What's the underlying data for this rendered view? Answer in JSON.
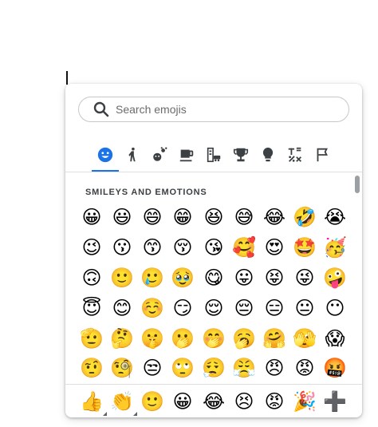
{
  "search": {
    "placeholder": "Search emojis",
    "value": ""
  },
  "tabs": [
    {
      "name": "smileys-emotions",
      "icon": "smiley-face-icon",
      "active": true
    },
    {
      "name": "people-body",
      "icon": "person-walking-icon",
      "active": false
    },
    {
      "name": "animals-nature",
      "icon": "animals-nature-icon",
      "active": false
    },
    {
      "name": "food-drink",
      "icon": "coffee-cup-icon",
      "active": false
    },
    {
      "name": "travel-places",
      "icon": "buildings-car-icon",
      "active": false
    },
    {
      "name": "activities",
      "icon": "trophy-icon",
      "active": false
    },
    {
      "name": "objects",
      "icon": "lightbulb-icon",
      "active": false
    },
    {
      "name": "symbols",
      "icon": "symbols-icon",
      "active": false
    },
    {
      "name": "flags",
      "icon": "flag-icon",
      "active": false
    }
  ],
  "section": {
    "title": "SMILEYS AND EMOTIONS"
  },
  "emoji_rows": [
    [
      "😀",
      "😃",
      "😄",
      "😁",
      "😆",
      "😅",
      "😂",
      "🤣",
      "😭"
    ],
    [
      "😉",
      "😗",
      "😙",
      "😚",
      "😘",
      "🥰",
      "😍",
      "🤩",
      "🥳"
    ],
    [
      "🙃",
      "🙂",
      "🥲",
      "🥹",
      "😋",
      "😛",
      "😝",
      "😜",
      "🤪"
    ],
    [
      "😇",
      "😊",
      "☺️",
      "😏",
      "😌",
      "😔",
      "😑",
      "😐",
      "😶"
    ],
    [
      "🫡",
      "🤔",
      "🤫",
      "🫢",
      "🤭",
      "🥱",
      "🤗",
      "🫣",
      "😱"
    ],
    [
      "🤨",
      "🧐",
      "😒",
      "🙄",
      "😮‍💨",
      "😤",
      "😠",
      "😡",
      "🤬"
    ]
  ],
  "recent": [
    {
      "char": "👍",
      "has_variants": true
    },
    {
      "char": "👏",
      "has_variants": true
    },
    {
      "char": "🙂",
      "has_variants": false
    },
    {
      "char": "😀",
      "has_variants": false
    },
    {
      "char": "😂",
      "has_variants": false
    },
    {
      "char": "😣",
      "has_variants": false
    },
    {
      "char": "😡",
      "has_variants": false
    },
    {
      "char": "🎉",
      "has_variants": false
    },
    {
      "char": "➕",
      "has_variants": false
    }
  ],
  "colors": {
    "accent": "#1a73e8",
    "icon": "#3c4043"
  }
}
